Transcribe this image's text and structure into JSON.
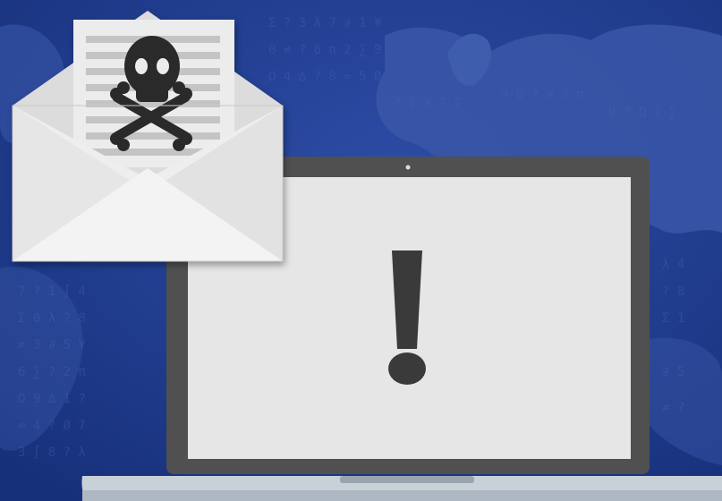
{
  "illustration": {
    "subject": "malicious-email-warning",
    "icons": [
      "map-icon",
      "envelope-icon",
      "skull-crossbones-icon",
      "laptop-icon",
      "exclamation-icon"
    ],
    "colors": {
      "background": "#213f95",
      "background_dark": "#17307a",
      "continent": "#3a57a8",
      "glyph": "#4d69b3",
      "envelope_body": "#eeeeee",
      "envelope_flap": "#e4e4e4",
      "envelope_shadow": "#c9c9c9",
      "letter_paper": "#ececec",
      "letter_lines": "#c4c4c4",
      "skull": "#2b2b2b",
      "laptop_bezel": "#505050",
      "laptop_screen": "#e6e6e6",
      "laptop_base": "#c8d0d8",
      "exclamation": "#3a3a3a"
    }
  }
}
